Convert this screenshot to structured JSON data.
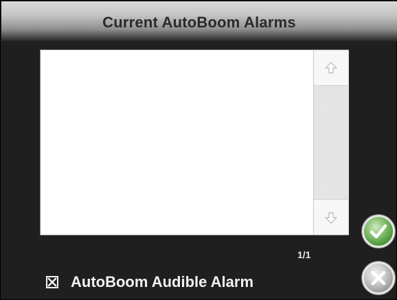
{
  "dialog": {
    "title": "Current AutoBoom Alarms"
  },
  "alarm_list": {
    "items": [],
    "page_indicator": "1/1"
  },
  "audible_alarm": {
    "label": "AutoBoom Audible Alarm",
    "checked": true
  },
  "buttons": {
    "ok_icon": "check-icon",
    "cancel_icon": "x-icon"
  },
  "colors": {
    "background": "#1f1f1f",
    "ok_green": "#4e9a3a",
    "cancel_gray": "#9a9a9a",
    "text_light": "#f2f2f2"
  }
}
